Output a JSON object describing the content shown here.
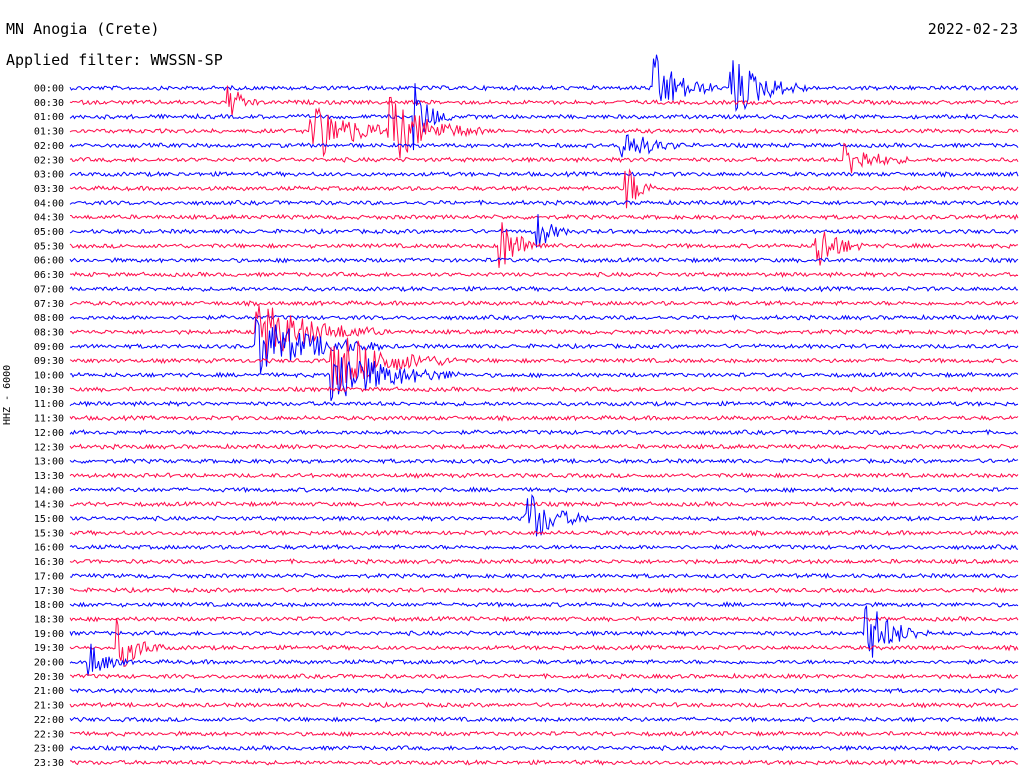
{
  "header": {
    "station": "MN Anogia (Crete)",
    "date": "2022-02-23",
    "filter": "Applied filter: WWSSN-SP",
    "channel": "HHZ - 6000"
  },
  "colors": {
    "trace_a": "#0000ff",
    "trace_b": "#ff0a4a"
  },
  "chart_data": {
    "type": "line",
    "title": "MN Anogia (Crete)",
    "subtitle": "Applied filter: WWSSN-SP",
    "ylabel": "HHZ - 6000",
    "row_labels": [
      "00:00",
      "00:30",
      "01:00",
      "01:30",
      "02:00",
      "02:30",
      "03:00",
      "03:30",
      "04:00",
      "04:30",
      "05:00",
      "05:30",
      "06:00",
      "06:30",
      "07:00",
      "07:30",
      "08:00",
      "08:30",
      "09:00",
      "09:30",
      "10:00",
      "10:30",
      "11:00",
      "11:30",
      "12:00",
      "12:30",
      "13:00",
      "13:30",
      "14:00",
      "14:30",
      "15:00",
      "15:30",
      "16:00",
      "16:30",
      "17:00",
      "17:30",
      "18:00",
      "18:30",
      "19:00",
      "19:30",
      "20:00",
      "20:30",
      "21:00",
      "21:30",
      "22:00",
      "22:30",
      "23:00",
      "23:30"
    ],
    "row_minutes": 30,
    "alternating_colors": [
      "blue",
      "red"
    ],
    "events": [
      {
        "row": "00:00",
        "minute": 18.5,
        "amp": 1.0,
        "dur": 2.0
      },
      {
        "row": "00:00",
        "minute": 20.9,
        "amp": 1.0,
        "dur": 2.5
      },
      {
        "row": "00:30",
        "minute": 5.0,
        "amp": 0.6,
        "dur": 1.0
      },
      {
        "row": "01:00",
        "minute": 10.9,
        "amp": 1.0,
        "dur": 1.2
      },
      {
        "row": "01:30",
        "minute": 7.6,
        "amp": 1.0,
        "dur": 3.0
      },
      {
        "row": "01:30",
        "minute": 10.1,
        "amp": 1.0,
        "dur": 3.0
      },
      {
        "row": "02:00",
        "minute": 17.4,
        "amp": 0.6,
        "dur": 2.0
      },
      {
        "row": "02:30",
        "minute": 24.5,
        "amp": 0.6,
        "dur": 2.0
      },
      {
        "row": "03:30",
        "minute": 17.6,
        "amp": 0.8,
        "dur": 1.0
      },
      {
        "row": "05:00",
        "minute": 14.8,
        "amp": 0.6,
        "dur": 1.0
      },
      {
        "row": "05:30",
        "minute": 13.6,
        "amp": 0.9,
        "dur": 1.5
      },
      {
        "row": "05:30",
        "minute": 23.6,
        "amp": 0.9,
        "dur": 1.5
      },
      {
        "row": "08:30",
        "minute": 5.9,
        "amp": 1.0,
        "dur": 4.0
      },
      {
        "row": "09:00",
        "minute": 5.9,
        "amp": 1.0,
        "dur": 4.0
      },
      {
        "row": "09:30",
        "minute": 8.3,
        "amp": 1.0,
        "dur": 4.0
      },
      {
        "row": "10:00",
        "minute": 8.3,
        "amp": 1.0,
        "dur": 4.0
      },
      {
        "row": "15:00",
        "minute": 14.4,
        "amp": 1.0,
        "dur": 2.0
      },
      {
        "row": "19:00",
        "minute": 25.2,
        "amp": 1.0,
        "dur": 2.0
      },
      {
        "row": "19:30",
        "minute": 1.5,
        "amp": 0.8,
        "dur": 1.5
      },
      {
        "row": "20:00",
        "minute": 0.6,
        "amp": 0.6,
        "dur": 1.2
      }
    ]
  }
}
